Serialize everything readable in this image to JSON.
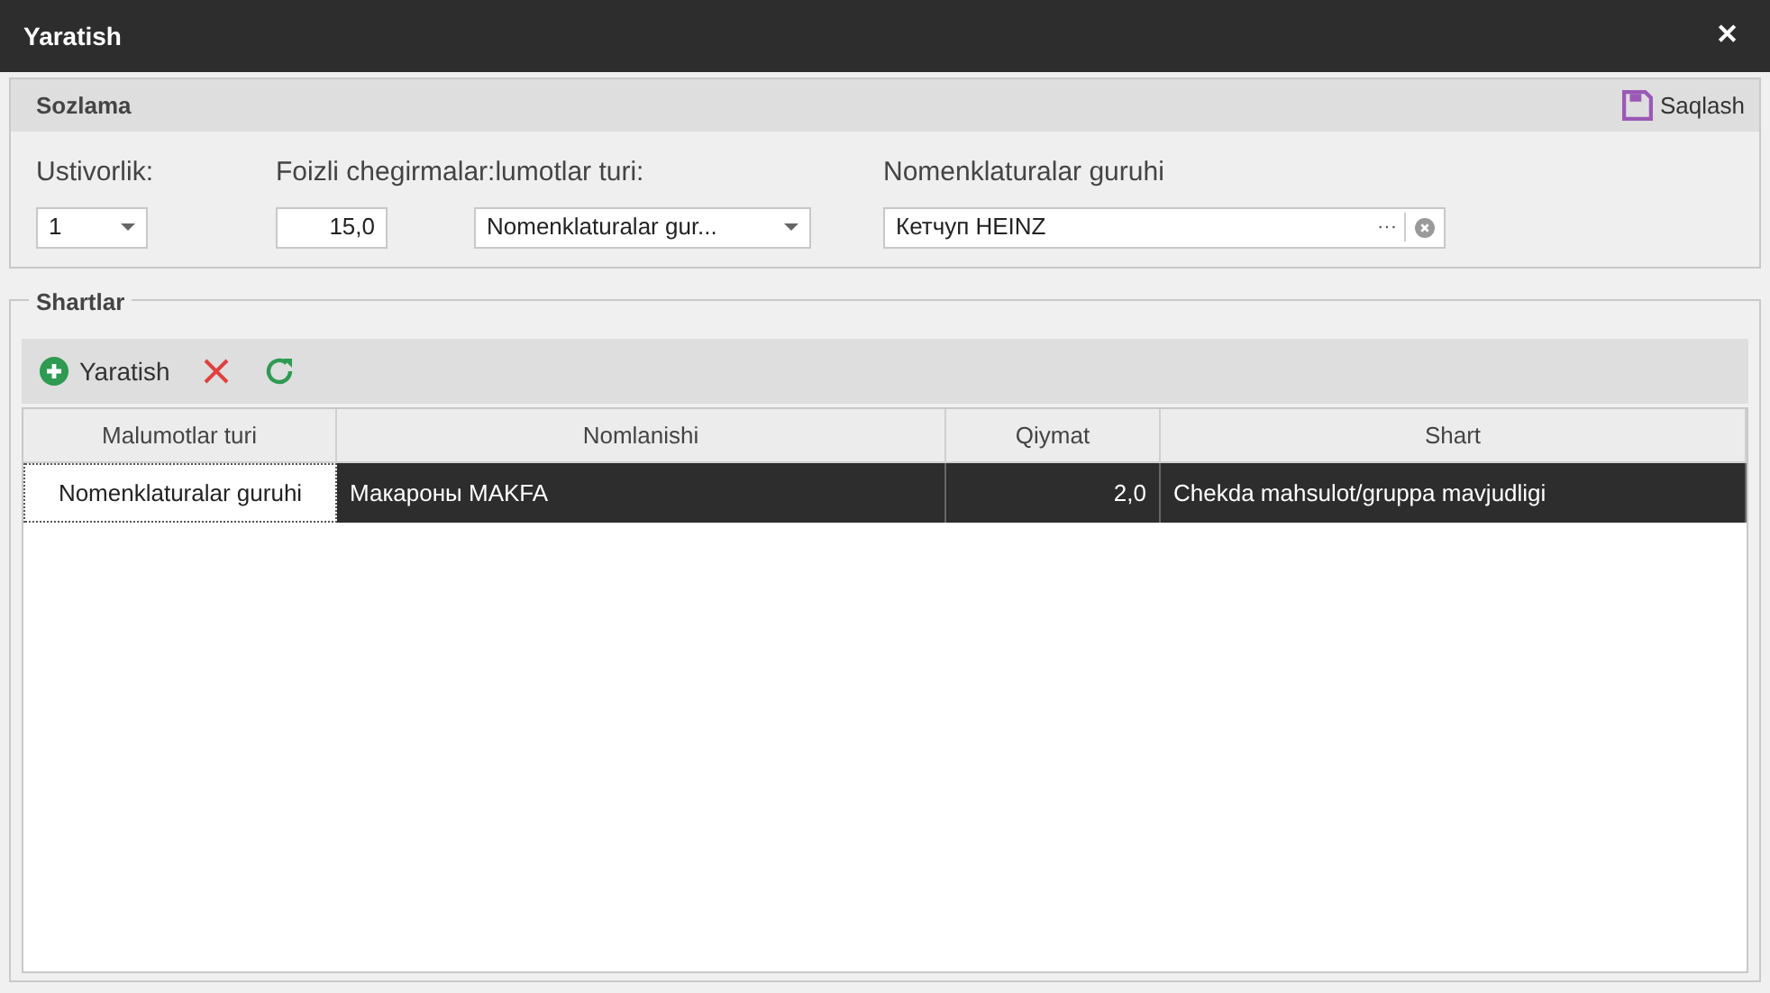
{
  "window": {
    "title": "Yaratish",
    "close": "✕"
  },
  "settings": {
    "title": "Sozlama",
    "save_button": "Saqlash",
    "fields": [
      {
        "kind": "dropdown",
        "label": "Ustivorlik:",
        "value": "1"
      },
      {
        "kind": "number",
        "label": "Foizli chegirmalar:",
        "value": "15,0"
      },
      {
        "kind": "dropdown",
        "label": "lumotlar turi:",
        "value": "Nomenklaturalar gur..."
      },
      {
        "kind": "lookup",
        "label": "Nomenklaturalar guruhi",
        "value": "Кетчуп HEINZ",
        "ellipsis": "···"
      }
    ]
  },
  "conditions": {
    "title": "Shartlar",
    "toolbar": {
      "create_button": "Yaratish"
    },
    "table": {
      "columns": [
        "Malumotlar turi",
        "Nomlanishi",
        "Qiymat",
        "Shart"
      ],
      "rows": [
        {
          "selected": true,
          "cells": [
            {
              "text": "Nomenklaturalar guruhi",
              "focused": true
            },
            {
              "text": "Макароны MAKFA",
              "focused": false
            },
            {
              "text": "2,0",
              "focused": false
            },
            {
              "text": "Chekda mahsulot/gruppa mavjudligi",
              "focused": false
            }
          ]
        }
      ]
    }
  }
}
